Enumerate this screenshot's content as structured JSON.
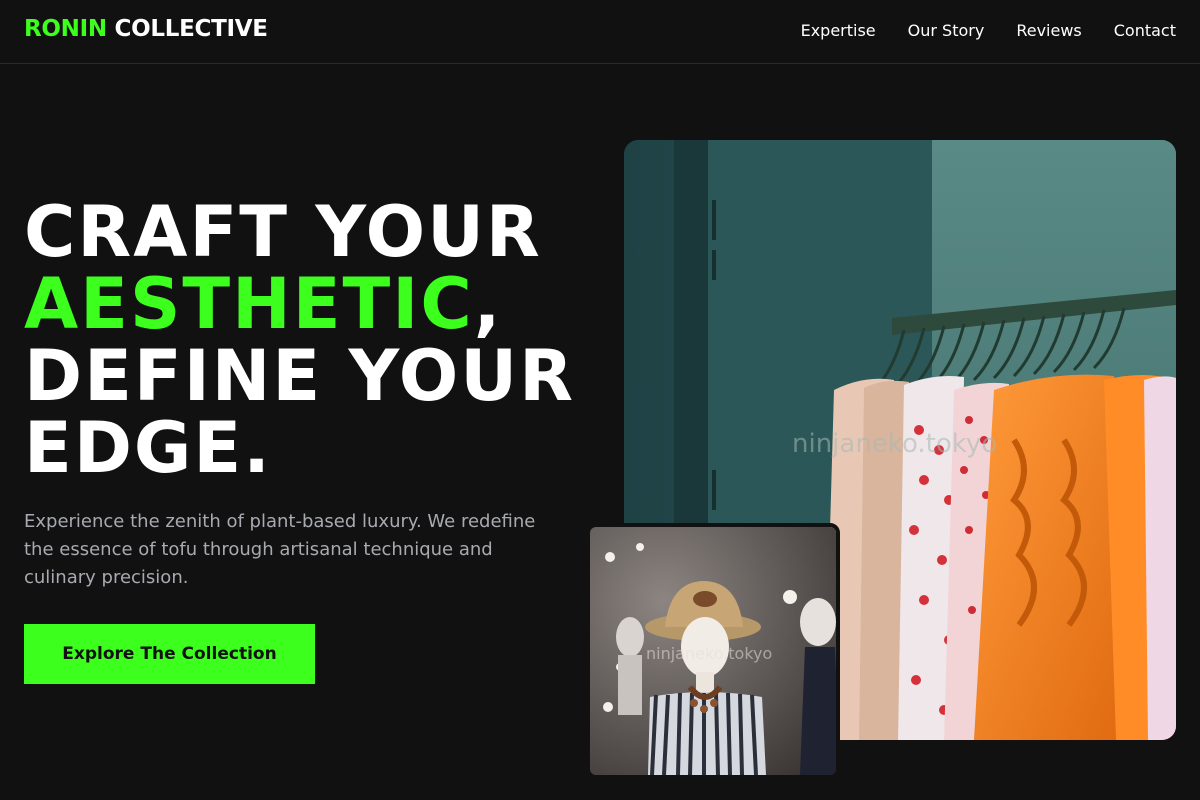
{
  "header": {
    "logo_accent": "RONIN",
    "logo_rest": "COLLECTIVE",
    "nav": [
      "Expertise",
      "Our Story",
      "Reviews",
      "Contact"
    ]
  },
  "hero": {
    "line1": "CRAFT YOUR",
    "line2_accent": "AESTHETIC",
    "line2_rest": ",",
    "line3": "DEFINE YOUR",
    "line4": "EDGE.",
    "description": "Experience the zenith of plant-based luxury. We redefine the essence of tofu through artisanal technique and culinary precision.",
    "cta_label": "Explore The Collection"
  },
  "images": {
    "main_alt": "Clothing rack with orange and patterned garments",
    "small_alt": "Mannequin wearing a straw hat and striped top",
    "watermark": "ninjaneko.tokyo"
  },
  "colors": {
    "background": "#111111",
    "accent": "#3cff1e",
    "text": "#ffffff",
    "muted": "#a8aab0"
  }
}
